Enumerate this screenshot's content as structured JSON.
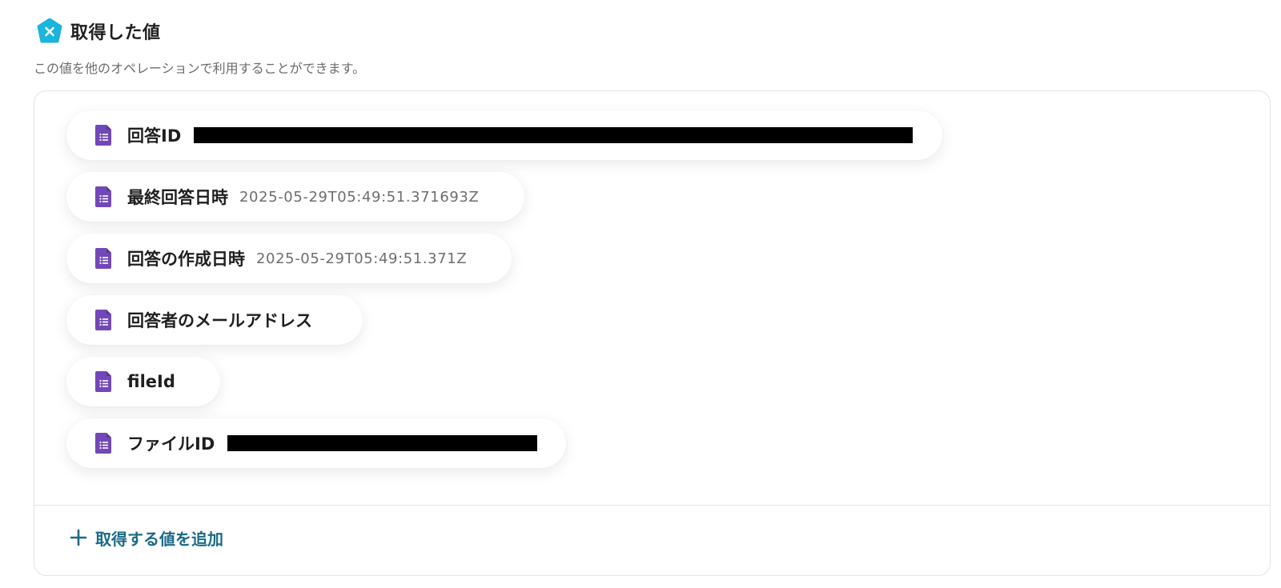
{
  "header": {
    "title": "取得した値",
    "icon": "yoom-logo-icon",
    "brand_color": "#1ab4dc"
  },
  "description": "この値を他のオペレーションで利用することができます。",
  "output_fields": [
    {
      "label": "回答ID",
      "value": "",
      "redacted": true,
      "icon": "google-forms-icon"
    },
    {
      "label": "最終回答日時",
      "value": "2025-05-29T05:49:51.371693Z",
      "redacted": false,
      "icon": "google-forms-icon"
    },
    {
      "label": "回答の作成日時",
      "value": "2025-05-29T05:49:51.371Z",
      "redacted": false,
      "icon": "google-forms-icon"
    },
    {
      "label": "回答者のメールアドレス",
      "value": "",
      "redacted": false,
      "icon": "google-forms-icon"
    },
    {
      "label": "fileId",
      "value": "",
      "redacted": false,
      "icon": "google-forms-icon"
    },
    {
      "label": "ファイルID",
      "value": "",
      "redacted": true,
      "icon": "google-forms-icon"
    }
  ],
  "add_button": {
    "label": "取得する値を追加",
    "icon": "plus-icon",
    "color": "#1b6b86"
  },
  "colors": {
    "forms_purple": "#7248b9",
    "border": "#e3e3e3"
  }
}
